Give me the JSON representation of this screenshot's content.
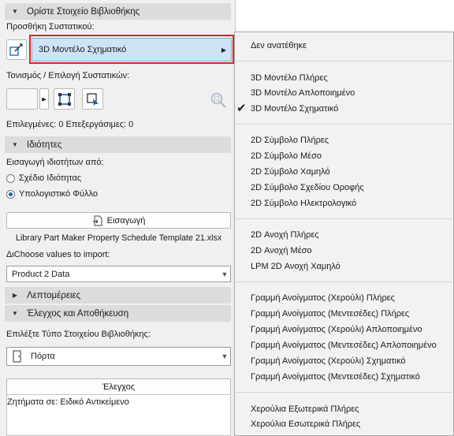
{
  "panel": {
    "set_section": "Ορίστε Στοιχείο Βιβλιοθήκης",
    "add_component_label": "Προσθήκη Συστατικού:",
    "selected_split_button": "3D Μοντέλο Σχηματικό",
    "highlight_label": "Τονισμός / Επιλογή Συστατικών:",
    "selection_status": "Επιλεγμένες: 0 Επεξεργάσιμες: 0",
    "properties_section": "Ιδιότητες",
    "import_from_label": "Εισαγωγή ιδιοτήτων από:",
    "radio_options": [
      "Σχέδιο Ιδιότητας",
      "Υπολογιστικό Φύλλο"
    ],
    "radio_selected_index": 1,
    "import_button": "Εισαγωγή",
    "file_name": "Library Part Maker Property Schedule Template 21.xlsx",
    "choose_values_label": "Choose values to import:",
    "choose_values_prefix": "Δι",
    "product_combo_value": "Product 2 Data",
    "details_section": "Λεπτομέρειες",
    "check_save_section": "Έλεγχος και Αποθήκευση",
    "select_type_label": "Επιλέξτε Τύπο Στοιχείου Βιβλιοθήκης:",
    "type_combo_value": "Πόρτα",
    "check_button": "Έλεγχος",
    "issues_label": "Ζητήματα σε: Ειδικό Αντικείμενο"
  },
  "menu": {
    "items": [
      "Δεν ανατέθηκε",
      "3D Μοντέλο Πλήρες",
      "3D Μοντέλο Απλοποιημένο",
      "3D Μοντέλο Σχηματικό",
      "2D Σύμβολο Πλήρες",
      "2D Σύμβολο Μέσο",
      "2D Σύμβολο Χαμηλό",
      "2D Σύμβολο Σχεδίου Οροφής",
      "2D Σύμβολο Ηλεκτρολογικό",
      "2D Ανοχή Πλήρες",
      "2D Ανοχή Μέσο",
      "LPM 2D Ανοχή Χαμηλό",
      "Γραμμή Ανοίγματος (Χερούλι) Πλήρες",
      "Γραμμή Ανοίγματος (Μεντεσέδες) Πλήρες",
      "Γραμμή Ανοίγματος (Χερούλι) Απλοποιημένο",
      "Γραμμή Ανοίγματος (Μεντεσέδες) Απλοποιημένο",
      "Γραμμή Ανοίγματος (Χερούλι) Σχηματικό",
      "Γραμμή Ανοίγματος (Μεντεσέδες) Σχηματικό",
      "Χερούλια Εξωτερικά Πλήρες",
      "Χερούλια Εσωτερικά Πλήρες"
    ],
    "checked_index": 3
  },
  "colors": {
    "accent": "#1b5fb5",
    "highlight": "#cfe3f7",
    "frame": "#e0232b"
  },
  "icons": [
    "triangle-down-icon",
    "triangle-right-icon",
    "add-component-icon",
    "select-component-icon",
    "zoom-icon",
    "import-icon",
    "door-icon",
    "check-mark-icon",
    "chevron-down-icon"
  ]
}
